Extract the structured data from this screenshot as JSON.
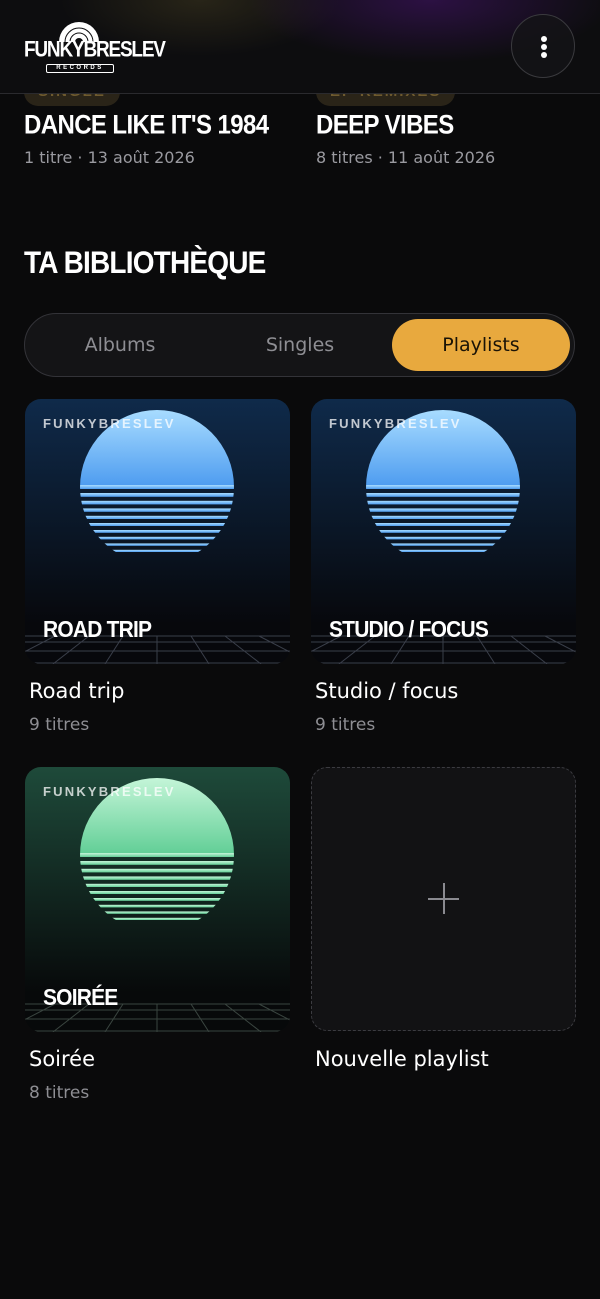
{
  "header": {
    "logo_text": "FUNKYBRESLEV",
    "logo_subtext": "RECORDS",
    "menu_icon": "more-vertical-icon"
  },
  "releases": [
    {
      "badge": "SINGLE",
      "title": "DANCE LIKE IT'S 1984",
      "meta": "1 titre · 13 août 2026"
    },
    {
      "badge": "EP REMIXES",
      "title": "DEEP VIBES",
      "meta": "8 titres · 11 août 2026"
    }
  ],
  "library": {
    "title": "TA BIBLIOTHÈQUE",
    "tabs": [
      {
        "label": "Albums",
        "active": false
      },
      {
        "label": "Singles",
        "active": false
      },
      {
        "label": "Playlists",
        "active": true
      }
    ],
    "accent_color": "#e8a93e",
    "playlists": [
      {
        "brand": "FUNKYBRESLEV",
        "cover_label": "ROAD TRIP",
        "title": "Road trip",
        "meta": "9 titres",
        "theme": "blue"
      },
      {
        "brand": "FUNKYBRESLEV",
        "cover_label": "STUDIO / FOCUS",
        "title": "Studio / focus",
        "meta": "9 titres",
        "theme": "blue"
      },
      {
        "brand": "FUNKYBRESLEV",
        "cover_label": "SOIRÉE",
        "title": "Soirée",
        "meta": "8 titres",
        "theme": "green"
      }
    ],
    "new_playlist": {
      "label": "Nouvelle playlist",
      "icon": "plus-icon"
    }
  }
}
